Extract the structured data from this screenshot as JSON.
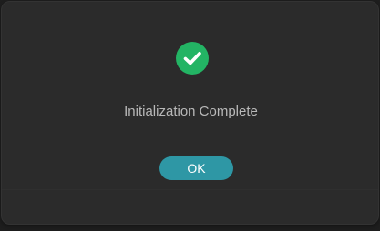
{
  "dialog": {
    "message": "Initialization Complete",
    "ok_label": "OK",
    "icon": "check-circle-icon"
  },
  "colors": {
    "background": "#1e1e1e",
    "dialog_bg": "#2b2b2b",
    "success_green": "#23b464",
    "button_teal": "#2e97a5",
    "message_text": "#b9b9b9"
  }
}
